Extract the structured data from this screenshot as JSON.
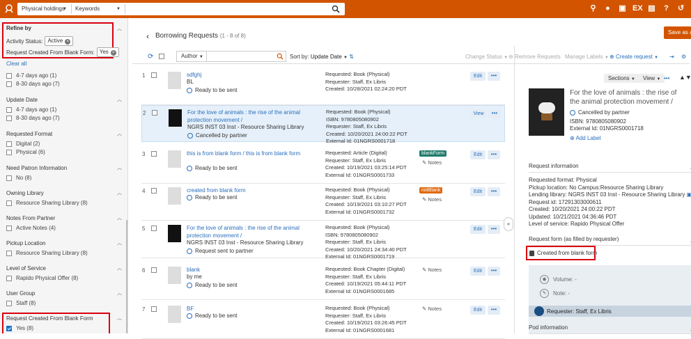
{
  "topbar": {
    "search_scope": "Physical holdings",
    "search_field": "Keywords",
    "icons": [
      "location-icon",
      "user-icon",
      "clipboard-icon",
      "ex-icon",
      "book-icon",
      "help-icon",
      "history-icon"
    ],
    "ex_label": "EX"
  },
  "refine": {
    "title": "Refine by",
    "activity_label": "Activity Status:",
    "activity_value": "Active",
    "blank_form_label": "Request Created From Blank Form:",
    "blank_form_value": "Yes",
    "clear_all": "Clear all"
  },
  "facets": [
    {
      "title": "",
      "options": [
        {
          "label": "4-7 days ago (1)",
          "checked": false
        },
        {
          "label": "8-30 days ago (7)",
          "checked": false
        }
      ]
    },
    {
      "title": "Update Date",
      "options": [
        {
          "label": "4-7 days ago (1)",
          "checked": false
        },
        {
          "label": "8-30 days ago (7)",
          "checked": false
        }
      ]
    },
    {
      "title": "Requested Format",
      "options": [
        {
          "label": "Digital (2)",
          "checked": false
        },
        {
          "label": "Physical (6)",
          "checked": false
        }
      ]
    },
    {
      "title": "Need Patron Information",
      "options": [
        {
          "label": "No (8)",
          "checked": false
        }
      ]
    },
    {
      "title": "Owning Library",
      "options": [
        {
          "label": "Resource Sharing Library (8)",
          "checked": false
        }
      ]
    },
    {
      "title": "Notes From Partner",
      "options": [
        {
          "label": "Active Notes (4)",
          "checked": false
        }
      ]
    },
    {
      "title": "Pickup Location",
      "options": [
        {
          "label": "Resource Sharing Library (8)",
          "checked": false
        }
      ]
    },
    {
      "title": "Level of Service",
      "options": [
        {
          "label": "Rapido Physical Offer (8)",
          "checked": false
        }
      ]
    },
    {
      "title": "User Group",
      "options": [
        {
          "label": "Staff (8)",
          "checked": false
        }
      ]
    },
    {
      "title": "Request Created From Blank Form",
      "options": [
        {
          "label": "Yes (8)",
          "checked": true
        }
      ]
    }
  ],
  "main": {
    "title": "Borrowing Requests",
    "count": "(1 - 8 of 8)",
    "author_dd": "Author",
    "sort_label": "Sort by:",
    "sort_value": "Update Date",
    "change_status": "Change Status",
    "remove_requests": "Remove Requests",
    "manage_labels": "Manage Labels",
    "create_request": "Create request",
    "save_as": "Save as a"
  },
  "rows": [
    {
      "num": "1",
      "title": "sdfghj",
      "sub": "BL",
      "status": "Ready to be sent",
      "meta": [
        "Requested: Book (Physical)",
        "Requester: Staff, Ex Libris",
        "Created: 10/28/2021 02:24:20 PDT"
      ],
      "tag": "",
      "tag_color": "",
      "notes": "",
      "btn": "Edit",
      "thumb": "blank"
    },
    {
      "num": "2",
      "title": "For the love of animals : the rise of the animal protection movement /",
      "sub": "NGRS INST 03 Inst - Resource Sharing Library",
      "status": "Cancelled by partner",
      "meta": [
        "Requested: Book (Physical)",
        "ISBN: 9780805080902",
        "Requester: Staff, Ex Libris",
        "Created: 10/20/2021 24:00:22 PDT",
        "External Id: 01NGRS0001718"
      ],
      "tag": "",
      "tag_color": "",
      "notes": "",
      "btn": "View",
      "thumb": "img"
    },
    {
      "num": "3",
      "title": "this is from blank form / this is from blank form",
      "sub": "",
      "status": "Ready to be sent",
      "meta": [
        "Requested: Article (Digital)",
        "Requester: Staff, Ex Libris",
        "Created: 10/19/2021 03:25:14 PDT",
        "External Id: 01NGRS0001733"
      ],
      "tag": "blankForm",
      "tag_color": "#1f7a6b",
      "notes": "Notes",
      "btn": "Edit",
      "thumb": "blank"
    },
    {
      "num": "4",
      "title": "created from blank form",
      "sub": "",
      "status": "Ready to be sent",
      "meta": [
        "Requested: Book (Physical)",
        "Requester: Staff, Ex Libris",
        "Created: 10/19/2021 03:10:27 PDT",
        "External Id: 01NGRS0001732"
      ],
      "tag": "notBlank",
      "tag_color": "#e06a10",
      "notes": "Notes",
      "btn": "Edit",
      "thumb": "blank"
    },
    {
      "num": "5",
      "title": "For the love of animals : the rise of the animal protection movement /",
      "sub": "NGRS INST 03 Inst - Resource Sharing Library",
      "status": "Request sent to partner",
      "meta": [
        "Requested: Book (Physical)",
        "ISBN: 9780805080902",
        "Requester: Staff, Ex Libris",
        "Created: 10/20/2021 24:34:40 PDT",
        "External Id: 01NGRS0001719"
      ],
      "tag": "",
      "tag_color": "",
      "notes": "",
      "btn": "Edit",
      "thumb": "img"
    },
    {
      "num": "6",
      "title": "blank",
      "sub": "by me",
      "status": "Ready to be sent",
      "meta": [
        "Requested: Book Chapter (Digital)",
        "Requester: Staff, Ex Libris",
        "Created: 10/19/2021 05:44:11 PDT",
        "External Id: 01NGRS0001685"
      ],
      "tag": "",
      "tag_color": "",
      "notes": "Notes",
      "btn": "Edit",
      "thumb": "blank"
    },
    {
      "num": "7",
      "title": "BF",
      "sub": "",
      "status": "Ready to be sent",
      "meta": [
        "Requested: Book (Physical)",
        "Requester: Staff, Ex Libris",
        "Created: 10/19/2021 03:26:45 PDT",
        "External Id: 01NGRS0001681"
      ],
      "tag": "",
      "tag_color": "",
      "notes": "Notes",
      "btn": "Edit",
      "thumb": "blank"
    }
  ],
  "detail": {
    "sections_label": "Sections",
    "view_label": "View",
    "title": "For the love of animals : the rise of the animal protection movement /",
    "status": "Cancelled by partner",
    "isbn": "ISBN: 9780805080902",
    "external_id": "External Id: 01NGRS0001718",
    "add_label": "Add Label",
    "req_info_title": "Request information",
    "req_info": [
      "Requested format: Physical",
      "Pickup location: No Campus:Resource Sharing Library",
      "Lending library: NGRS INST 03 Inst - Resource Sharing Library",
      "Request id: 17291303000611",
      "Created: 10/20/2021 24:00:22 PDT",
      "Updated: 10/21/2021 04:36:46 PDT",
      "Level of service: Rapido Physical Offer"
    ],
    "form_title": "Request form (as filled by requester)",
    "created_blank": "Created from blank form",
    "volume": "Volume:",
    "volume_val": "-",
    "note": "Note:",
    "note_val": "-",
    "requester": "Requester: Staff, Ex Libris",
    "pod_title": "Pod information"
  }
}
